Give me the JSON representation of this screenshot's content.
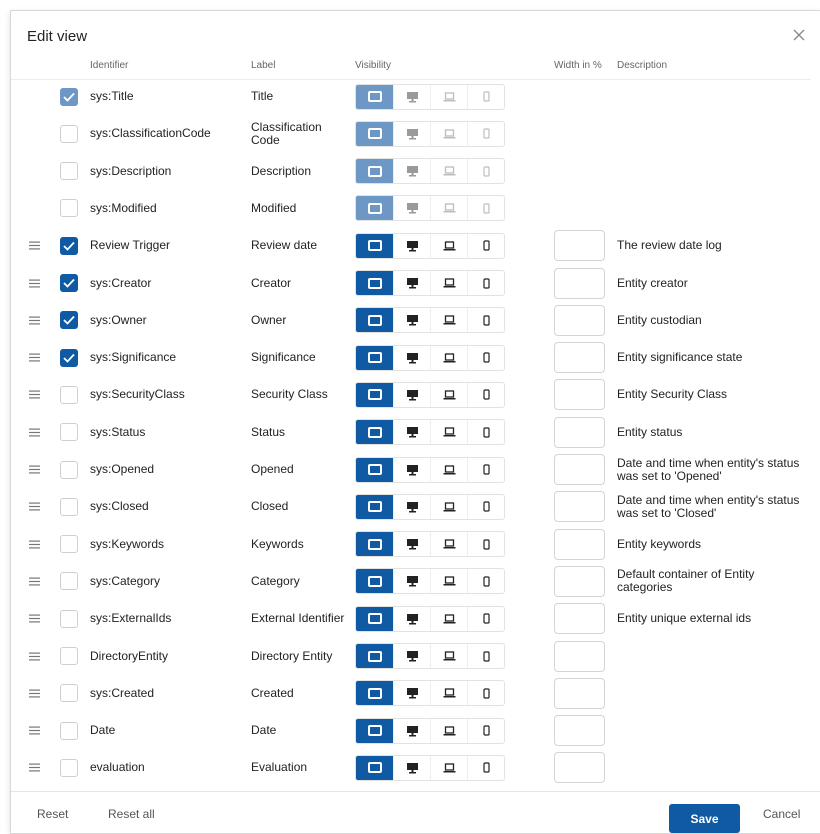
{
  "dialog": {
    "title": "Edit view"
  },
  "columns": {
    "identifier": "Identifier",
    "label": "Label",
    "visibility": "Visibility",
    "width": "Width in %",
    "description": "Description"
  },
  "icons": {
    "close": "close-icon",
    "drag": "drag-handle-icon",
    "check": "checkmark-icon",
    "visibility": [
      "window-icon",
      "desktop-icon",
      "laptop-icon",
      "phone-icon"
    ]
  },
  "colors": {
    "primary": "#0f5aa3",
    "primary_light": "#6d98c6"
  },
  "rows": [
    {
      "identifier": "sys:Title",
      "label": "Title",
      "description": "",
      "checked": true,
      "fixed": true
    },
    {
      "identifier": "sys:ClassificationCode",
      "label": "Classification Code",
      "description": "",
      "checked": false,
      "fixed": true
    },
    {
      "identifier": "sys:Description",
      "label": "Description",
      "description": "",
      "checked": false,
      "fixed": true
    },
    {
      "identifier": "sys:Modified",
      "label": "Modified",
      "description": "",
      "checked": false,
      "fixed": true
    },
    {
      "identifier": "Review Trigger",
      "label": "Review date",
      "description": "The review date log",
      "checked": true,
      "fixed": false
    },
    {
      "identifier": "sys:Creator",
      "label": "Creator",
      "description": "Entity creator",
      "checked": true,
      "fixed": false
    },
    {
      "identifier": "sys:Owner",
      "label": "Owner",
      "description": "Entity custodian",
      "checked": true,
      "fixed": false
    },
    {
      "identifier": "sys:Significance",
      "label": "Significance",
      "description": "Entity significance state",
      "checked": true,
      "fixed": false
    },
    {
      "identifier": "sys:SecurityClass",
      "label": "Security Class",
      "description": "Entity Security Class",
      "checked": false,
      "fixed": false
    },
    {
      "identifier": "sys:Status",
      "label": "Status",
      "description": "Entity status",
      "checked": false,
      "fixed": false
    },
    {
      "identifier": "sys:Opened",
      "label": "Opened",
      "description": "Date and time when entity's status was set to 'Opened'",
      "checked": false,
      "fixed": false
    },
    {
      "identifier": "sys:Closed",
      "label": "Closed",
      "description": "Date and time when entity's status was set to 'Closed'",
      "checked": false,
      "fixed": false
    },
    {
      "identifier": "sys:Keywords",
      "label": "Keywords",
      "description": "Entity keywords",
      "checked": false,
      "fixed": false
    },
    {
      "identifier": "sys:Category",
      "label": "Category",
      "description": "Default container of Entity categories",
      "checked": false,
      "fixed": false
    },
    {
      "identifier": "sys:ExternalIds",
      "label": "External Identifier",
      "description": "Entity unique external ids",
      "checked": false,
      "fixed": false
    },
    {
      "identifier": "DirectoryEntity",
      "label": "Directory Entity",
      "description": "",
      "checked": false,
      "fixed": false
    },
    {
      "identifier": "sys:Created",
      "label": "Created",
      "description": "",
      "checked": false,
      "fixed": false
    },
    {
      "identifier": "Date",
      "label": "Date",
      "description": "",
      "checked": false,
      "fixed": false
    },
    {
      "identifier": "evaluation",
      "label": "Evaluation",
      "description": "",
      "checked": false,
      "fixed": false
    },
    {
      "identifier": "",
      "label": "",
      "description": "",
      "checked": false,
      "fixed": false
    }
  ],
  "footer": {
    "reset": "Reset",
    "reset_all": "Reset all",
    "save": "Save",
    "cancel": "Cancel"
  }
}
